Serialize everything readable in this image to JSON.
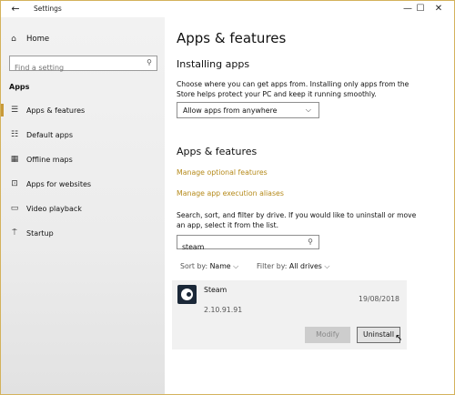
{
  "window": {
    "title": "Settings",
    "back_glyph": "←",
    "minimize_glyph": "—",
    "maximize_glyph": "☐",
    "close_glyph": "✕"
  },
  "sidebar": {
    "home_label": "Home",
    "search_placeholder": "Find a setting",
    "section_label": "Apps",
    "items": [
      {
        "label": "Apps & features",
        "icon": "list-icon"
      },
      {
        "label": "Default apps",
        "icon": "default-apps-icon"
      },
      {
        "label": "Offline maps",
        "icon": "map-icon"
      },
      {
        "label": "Apps for websites",
        "icon": "web-apps-icon"
      },
      {
        "label": "Video playback",
        "icon": "video-icon"
      },
      {
        "label": "Startup",
        "icon": "startup-icon"
      }
    ]
  },
  "main": {
    "title": "Apps & features",
    "installing": {
      "heading": "Installing apps",
      "description": "Choose where you can get apps from. Installing only apps from the Store helps protect your PC and keep it running smoothly.",
      "dropdown_value": "Allow apps from anywhere"
    },
    "features": {
      "heading": "Apps & features",
      "link_optional": "Manage optional features",
      "link_aliases": "Manage app execution aliases",
      "description": "Search, sort, and filter by drive. If you would like to uninstall or move an app, select it from the list.",
      "search_value": "steam",
      "sort_label": "Sort by:",
      "sort_value": "Name",
      "filter_label": "Filter by:",
      "filter_value": "All drives"
    },
    "app": {
      "name": "Steam",
      "date": "19/08/2018",
      "version": "2.10.91.91",
      "modify_label": "Modify",
      "uninstall_label": "Uninstall"
    }
  },
  "colors": {
    "accent": "#b58a1a",
    "active_bar": "#c89a3a",
    "border": "#d4b25c"
  }
}
